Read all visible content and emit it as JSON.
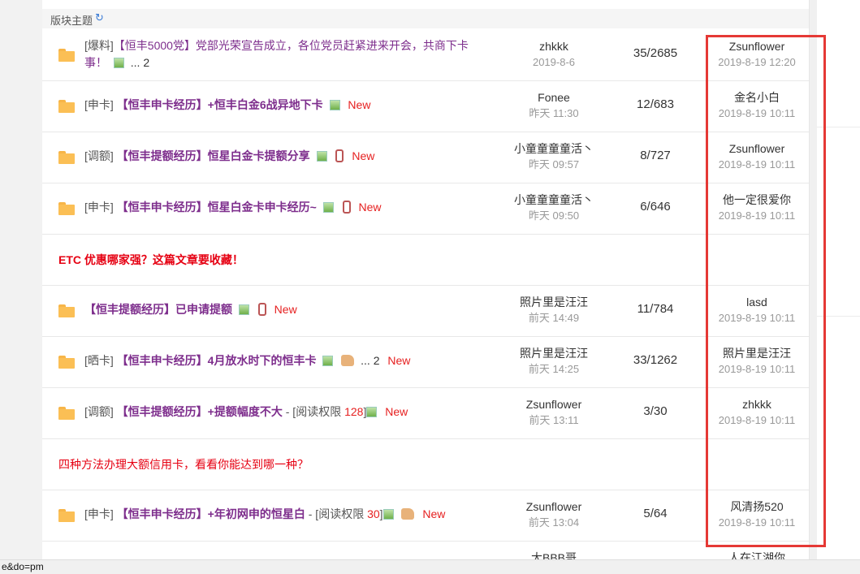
{
  "section": {
    "title": "版块主题"
  },
  "threads": [
    {
      "kind": "thread",
      "tag": "[爆料]",
      "title": "【恒丰5000党】党部光荣宣告成立，各位党员赶紧进来开会，共商下卡事！",
      "title_line2": "事！",
      "title_line1": "【恒丰5000党】党部光荣宣告成立，各位党员赶紧进来开会，共商下卡",
      "pages": "... 2",
      "author": "zhkkk",
      "author_date": "2019-8-6",
      "count": "35/2685",
      "last_user": "Zsunflower",
      "last_date": "2019-8-19 12:20"
    },
    {
      "kind": "thread",
      "tag": "[申卡]",
      "title": "【恒丰申卡经历】+恒丰白金6战异地下卡",
      "new": "New",
      "author": "Fonee",
      "author_date": "昨天 11:30",
      "count": "12/683",
      "last_user": "金名小白",
      "last_date": "2019-8-19 10:11"
    },
    {
      "kind": "thread",
      "tag": "[调额]",
      "title": "【恒丰提额经历】恒星白金卡提额分享",
      "new": "New",
      "author": "小童童童童活丶",
      "author_date": "昨天 09:57",
      "count": "8/727",
      "last_user": "Zsunflower",
      "last_date": "2019-8-19 10:11"
    },
    {
      "kind": "thread",
      "tag": "[申卡]",
      "title": "【恒丰申卡经历】恒星白金卡申卡经历~",
      "new": "New",
      "author": "小童童童童活丶",
      "author_date": "昨天 09:50",
      "count": "6/646",
      "last_user": "他一定很爱你",
      "last_date": "2019-8-19 10:11"
    },
    {
      "kind": "ad",
      "text": "ETC 优惠哪家强？这篇文章要收藏！"
    },
    {
      "kind": "thread",
      "tag": "",
      "title": "【恒丰提额经历】已申请提额",
      "new": "New",
      "author": "照片里是汪汪",
      "author_date": "前天 14:49",
      "count": "11/784",
      "last_user": "lasd",
      "last_date": "2019-8-19 10:11"
    },
    {
      "kind": "thread",
      "tag": "[晒卡]",
      "title": "【恒丰申卡经历】4月放水时下的恒丰卡",
      "pages": "... 2",
      "new": "New",
      "author": "照片里是汪汪",
      "author_date": "前天 14:25",
      "count": "33/1262",
      "last_user": "照片里是汪汪",
      "last_date": "2019-8-19 10:11"
    },
    {
      "kind": "thread",
      "tag": "[调额]",
      "title": "【恒丰提额经历】+提额幅度不大",
      "perm_prefix": " - [阅读权限 ",
      "perm_value": "128",
      "perm_suffix": "]",
      "new": "New",
      "author": "Zsunflower",
      "author_date": "前天 13:11",
      "count": "3/30",
      "last_user": "zhkkk",
      "last_date": "2019-8-19 10:11"
    },
    {
      "kind": "ad",
      "text": "四种方法办理大额信用卡，看看你能达到哪一种？"
    },
    {
      "kind": "thread",
      "tag": "[申卡]",
      "title": "【恒丰申卡经历】+年初网申的恒星白",
      "perm_prefix": " - [阅读权限 ",
      "perm_value": "30",
      "perm_suffix": "]",
      "new": "New",
      "author": "Zsunflower",
      "author_date": "前天 13:04",
      "count": "5/64",
      "last_user": "风清扬520",
      "last_date": "2019-8-19 10:11"
    },
    {
      "kind": "thread-partial",
      "author": "大BBB哥",
      "last_user": "人在江湖你"
    }
  ],
  "status_url": "e&do=pm",
  "colors": {
    "highlight": "#e53935",
    "thread_title": "#7d2d8c",
    "new_badge": "#e62020",
    "ad_red": "#e60012"
  },
  "icons": [
    "folder-icon",
    "image-attachment-icon",
    "mobile-post-icon",
    "thumbs-up-icon",
    "refresh-icon"
  ]
}
